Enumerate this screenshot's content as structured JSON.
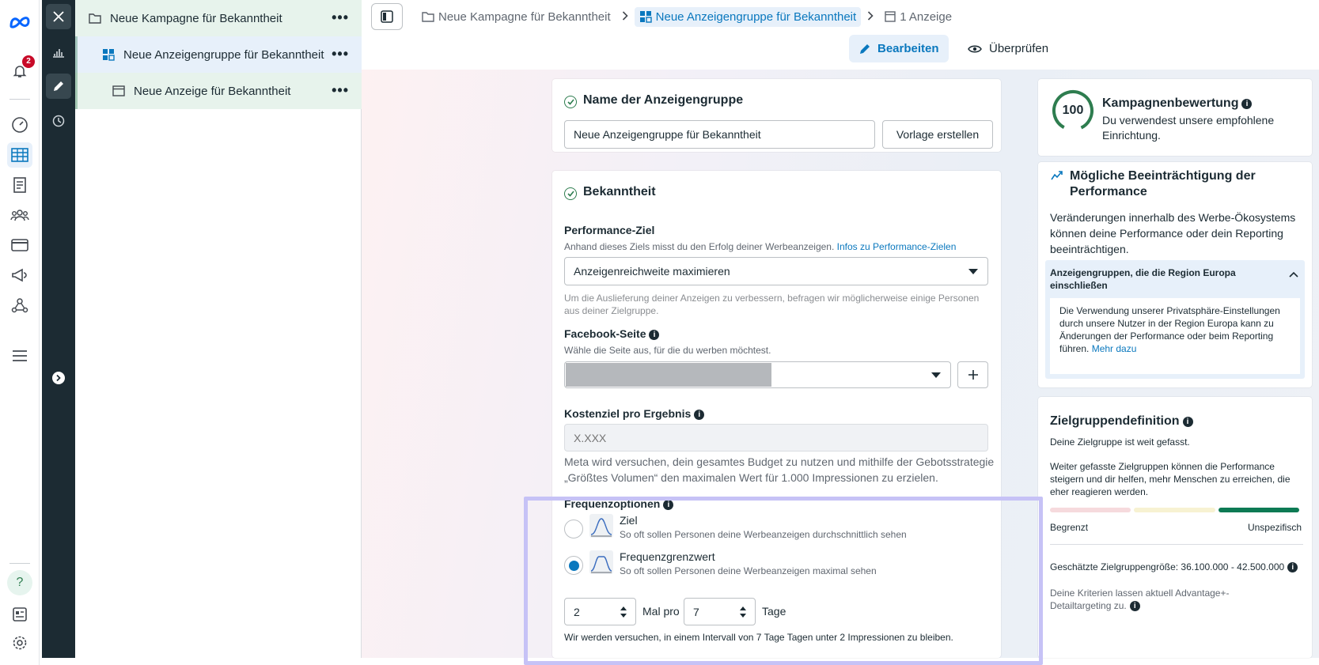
{
  "rail": {
    "notifications_count": "2"
  },
  "tree": {
    "campaign": "Neue Kampagne für Bekanntheit",
    "adset": "Neue Anzeigengruppe für Bekanntheit",
    "ad": "Neue Anzeige für Bekanntheit",
    "more": "•••"
  },
  "breadcrumb": {
    "campaign": "Neue Kampagne für Bekanntheit",
    "adset": "Neue Anzeigengruppe für Bekanntheit",
    "ad": "1 Anzeige"
  },
  "toolbar": {
    "edit": "Bearbeiten",
    "review": "Überprüfen"
  },
  "name_card": {
    "title": "Name der Anzeigengruppe",
    "value": "Neue Anzeigengruppe für Bekanntheit",
    "template_button": "Vorlage erstellen"
  },
  "awareness": {
    "title": "Bekanntheit",
    "perf_label": "Performance-Ziel",
    "perf_desc": "Anhand dieses Ziels misst du den Erfolg deiner Werbeanzeigen.",
    "perf_link": "Infos zu Performance-Zielen",
    "perf_value": "Anzeigenreichweite maximieren",
    "perf_note": "Um die Auslieferung deiner Anzeigen zu verbessern, befragen wir möglicherweise einige Personen aus deiner Zielgruppe.",
    "page_label": "Facebook-Seite",
    "page_desc": "Wähle die Seite aus, für die du werben möchtest.",
    "cost_label": "Kostenziel pro Ergebnis",
    "cost_placeholder": "X.XXX",
    "cost_note": "Meta wird versuchen, dein gesamtes Budget zu nutzen und mithilfe der Gebotsstrategie „Größtes Volumen“ den maximalen Wert für 1.000 Impressionen zu erzielen.",
    "freq_label": "Frequenzoptionen",
    "opt1_title": "Ziel",
    "opt1_desc": "So oft sollen Personen deine Werbeanzeigen durchschnittlich sehen",
    "opt2_title": "Frequenzgrenzwert",
    "opt2_desc": "So oft sollen Personen deine Werbeanzeigen maximal sehen",
    "times_value": "2",
    "times_label": "Mal pro",
    "days_value": "7",
    "days_label": "Tage",
    "freq_summary": "Wir werden versuchen, in einem Intervall von 7 Tage Tagen unter 2 Impressionen zu bleiben."
  },
  "score": {
    "value": "100",
    "title": "Kampagnenbewertung",
    "desc": "Du verwendest unsere empfohlene Einrichtung."
  },
  "perf_impact": {
    "title": "Mögliche Beeinträchtigung der Performance",
    "desc": "Veränderungen innerhalb des Werbe-Ökosystems können deine Performance oder dein Reporting beeinträchtigen.",
    "region_title": "Anzeigengruppen, die die Region Europa einschließen",
    "region_desc": "Die Verwendung unserer Privatsphäre-Einstellungen durch unsere Nutzer in der Region Europa kann zu Änderungen der Performance oder beim Reporting führen.",
    "region_link": "Mehr dazu"
  },
  "audience": {
    "title": "Zielgruppendefinition",
    "status": "Deine Zielgruppe ist weit gefasst.",
    "desc": "Weiter gefasste Zielgruppen können die Performance steigern und dir helfen, mehr Menschen zu erreichen, die eher reagieren werden.",
    "left_label": "Begrenzt",
    "right_label": "Unspezifisch",
    "size": "Geschätzte Zielgruppengröße: 36.100.000 - 42.500.000",
    "note": "Deine Kriterien lassen aktuell Advantage+-Detailtargeting zu."
  },
  "colors": {
    "accent": "#0a78be",
    "dark_rail": "#1c2b33",
    "success": "#2e7d4f",
    "highlight": "#c6c2f6"
  }
}
